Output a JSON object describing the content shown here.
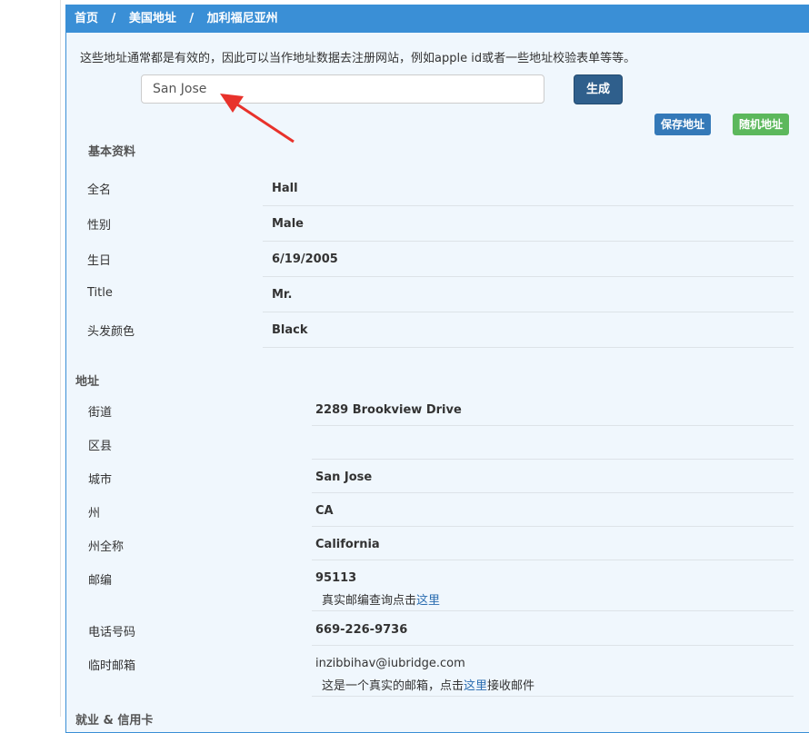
{
  "breadcrumb": {
    "home": "首页",
    "country": "美国地址",
    "state": "加利福尼亚州",
    "separator": "/"
  },
  "intro_text": "这些地址通常都是有效的，因此可以当作地址数据去注册网站，例如apple id或者一些地址校验表单等等。",
  "search": {
    "value": "San Jose"
  },
  "buttons": {
    "generate": "生成",
    "save": "保存地址",
    "random": "随机地址"
  },
  "basic": {
    "title": "基本资料",
    "rows": [
      {
        "label": "全名",
        "value": "Hall"
      },
      {
        "label": "性别",
        "value": "Male"
      },
      {
        "label": "生日",
        "value": "6/19/2005"
      },
      {
        "label": "Title",
        "value": "Mr."
      },
      {
        "label": "头发颜色",
        "value": "Black"
      }
    ]
  },
  "address": {
    "title": "地址",
    "rows": [
      {
        "label": "街道",
        "value": "2289  Brookview Drive"
      },
      {
        "label": "区县",
        "value": ""
      },
      {
        "label": "城市",
        "value": "San Jose"
      },
      {
        "label": "州",
        "value": "CA"
      },
      {
        "label": "州全称",
        "value": "California"
      },
      {
        "label": "邮编",
        "value": "95113",
        "note_prefix": "真实邮编查询点击",
        "note_link": "这里",
        "note_suffix": ""
      },
      {
        "label": "电话号码",
        "value": "669-226-9736"
      },
      {
        "label": "临时邮箱",
        "value": "inzibbihav@iubridge.com",
        "note_prefix": "这是一个真实的邮箱，点击",
        "note_link": "这里",
        "note_suffix": "接收邮件"
      }
    ]
  },
  "next_section_title": "就业 & 信用卡",
  "colors": {
    "header_blue": "#3a8fd6",
    "generate_button": "#2f5f8c",
    "save_button": "#3479b8",
    "random_button": "#5cb85c",
    "arrow": "#e8322b",
    "link": "#2a6db0"
  }
}
